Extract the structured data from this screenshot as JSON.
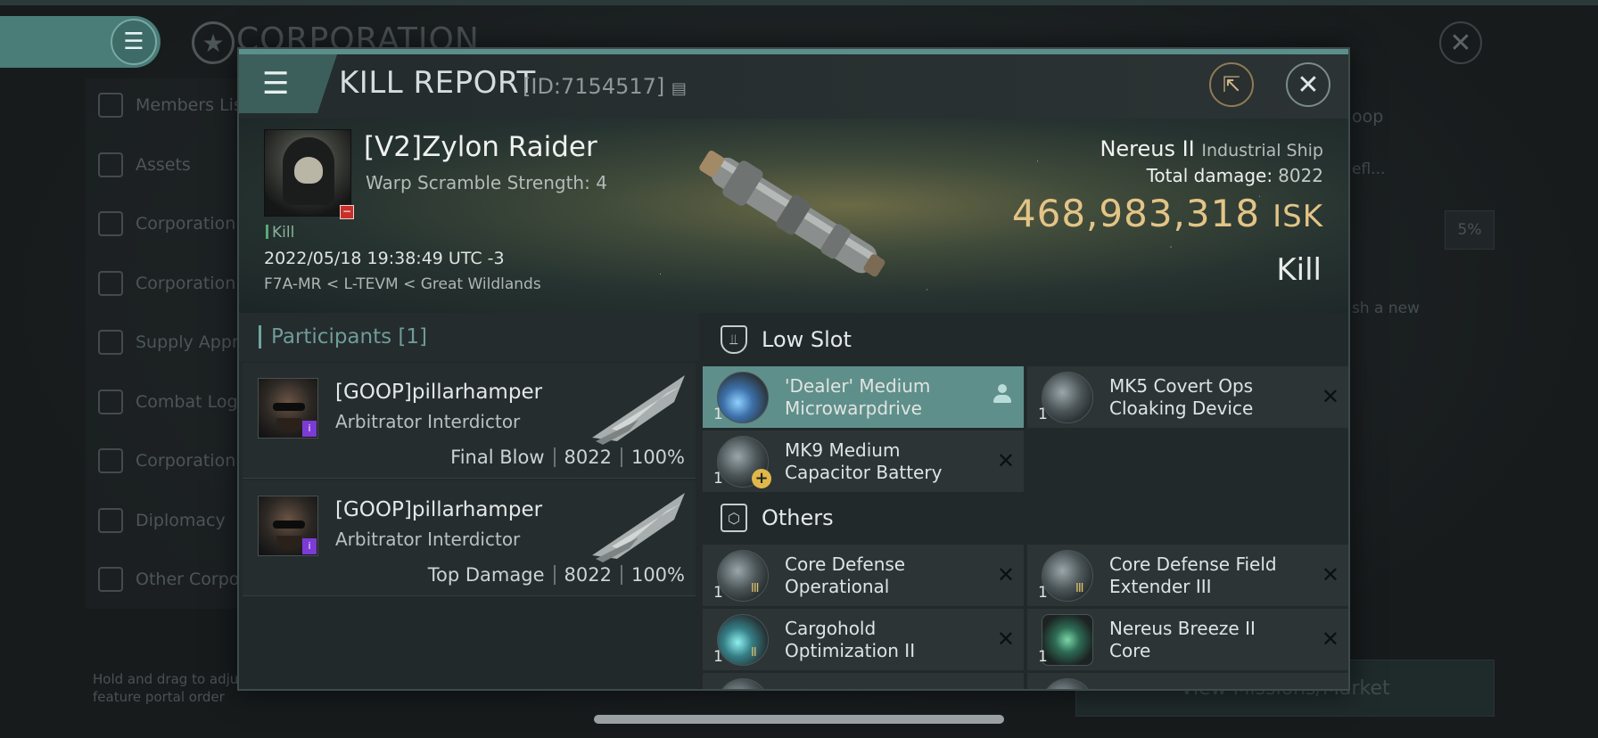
{
  "background": {
    "corp_title": "CORPORATION",
    "sidebar_items": [
      {
        "label": "Members List"
      },
      {
        "label": "Assets"
      },
      {
        "label": "Corporation F"
      },
      {
        "label": "Corporation W"
      },
      {
        "label": "Supply Approv"
      },
      {
        "label": "Combat Log"
      },
      {
        "label": "Corporation Li"
      },
      {
        "label": "Diplomacy"
      },
      {
        "label": "Other Corpora"
      }
    ],
    "hint": "Hold and drag to adjust feature portal order",
    "right_text_1": "oop",
    "right_text_2": "efl...",
    "right_text_3": "sh a new",
    "pct_value": "5%",
    "view_missions": "View Missions/Market"
  },
  "dialog": {
    "title": "KILL REPORT",
    "id_label": "[ID:7154517]",
    "victim": {
      "name": "[V2]Zylon Raider",
      "sub": "Warp Scramble Strength: 4",
      "tag": "Kill",
      "date": "2022/05/18 19:38:49 UTC -3",
      "location": "F7A-MR < L-TEVM < Great Wildlands"
    },
    "ship": {
      "name": "Nereus II",
      "class": "Industrial Ship",
      "damage_label": "Total damage:",
      "damage_value": "8022",
      "isk_value": "468,983,318",
      "isk_unit": "ISK",
      "result": "Kill"
    },
    "participants": {
      "title": "Participants [1]",
      "rows": [
        {
          "name": "[GOOP]pillarhamper",
          "ship": "Arbitrator Interdictor",
          "role": "Final Blow",
          "damage": "8022",
          "percent": "100%"
        },
        {
          "name": "[GOOP]pillarhamper",
          "ship": "Arbitrator Interdictor",
          "role": "Top Damage",
          "damage": "8022",
          "percent": "100%"
        }
      ]
    },
    "low_slot": {
      "title": "Low Slot",
      "items": [
        {
          "name": "'Dealer' Medium Microwarpdrive",
          "qty": "1"
        },
        {
          "name": "MK5 Covert Ops Cloaking Device",
          "qty": "1"
        },
        {
          "name": "MK9 Medium Capacitor Battery",
          "qty": "1"
        }
      ]
    },
    "others": {
      "title": "Others",
      "items": [
        {
          "name": "Core Defense Operational Solidifier...",
          "qty": "1"
        },
        {
          "name": "Core Defense Field Extender III",
          "qty": "1"
        },
        {
          "name": "Cargohold Optimization II",
          "qty": "1"
        },
        {
          "name": "Nereus Breeze II Core",
          "qty": "1"
        }
      ]
    }
  }
}
